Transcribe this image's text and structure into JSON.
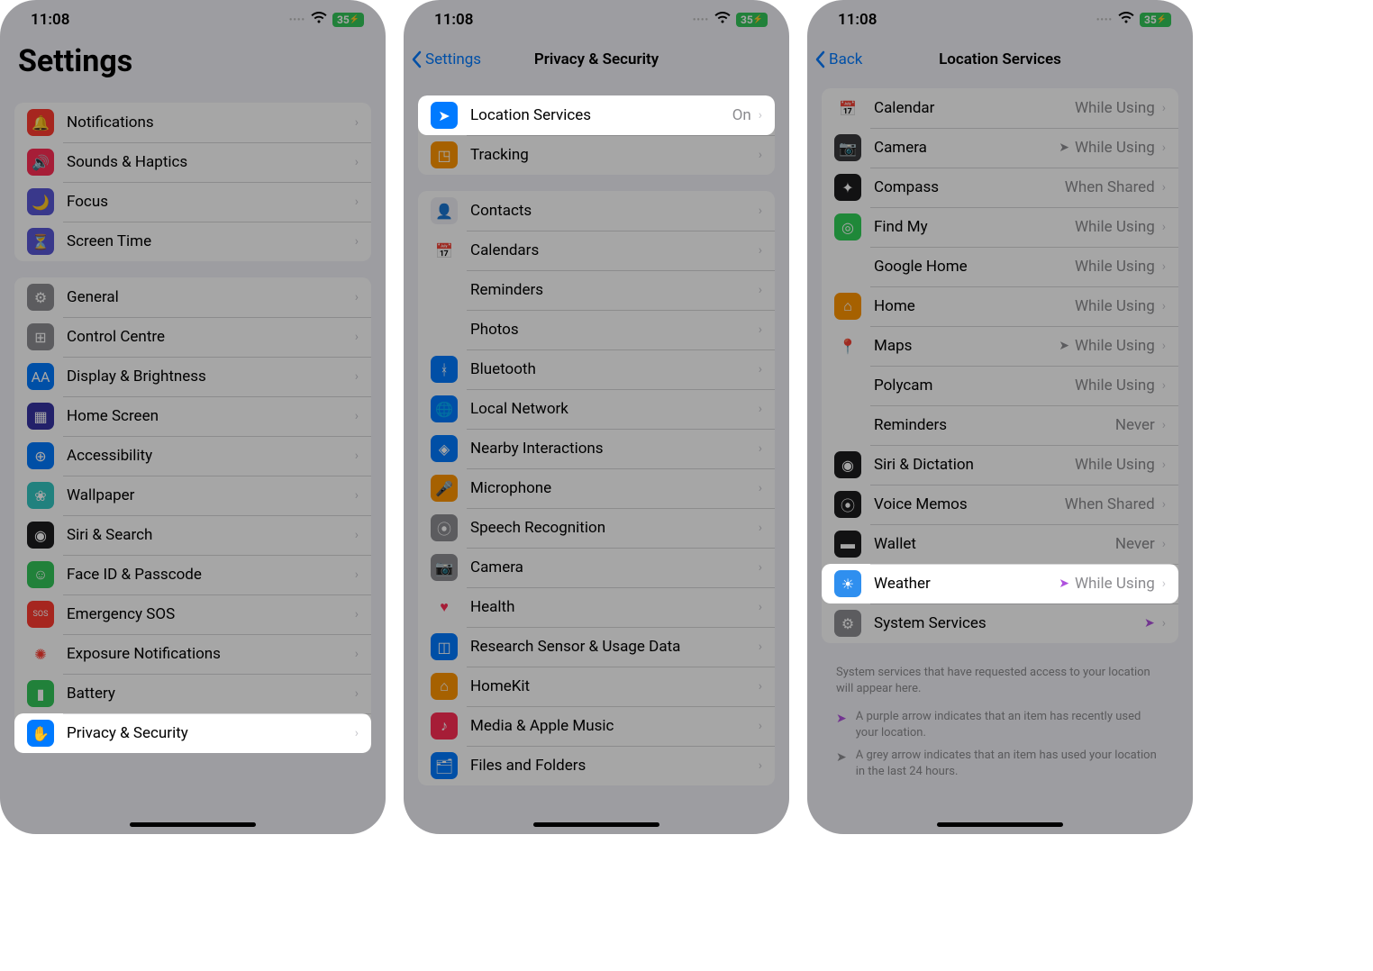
{
  "status": {
    "time": "11:08",
    "battery": "35"
  },
  "panel1": {
    "title": "Settings",
    "group1": [
      {
        "label": "Notifications",
        "color": "#ff3b30",
        "glyph": "🔔"
      },
      {
        "label": "Sounds & Haptics",
        "color": "#ff2d55",
        "glyph": "🔊"
      },
      {
        "label": "Focus",
        "color": "#5856d6",
        "glyph": "🌙"
      },
      {
        "label": "Screen Time",
        "color": "#5856d6",
        "glyph": "⏳"
      }
    ],
    "group2": [
      {
        "label": "General",
        "color": "#8e8e93",
        "glyph": "⚙"
      },
      {
        "label": "Control Centre",
        "color": "#8e8e93",
        "glyph": "⊞"
      },
      {
        "label": "Display & Brightness",
        "color": "#007aff",
        "glyph": "AA"
      },
      {
        "label": "Home Screen",
        "color": "#3634a3",
        "glyph": "▦"
      },
      {
        "label": "Accessibility",
        "color": "#007aff",
        "glyph": "⊕"
      },
      {
        "label": "Wallpaper",
        "color": "#34c7c2",
        "glyph": "❀"
      },
      {
        "label": "Siri & Search",
        "color": "#1c1c1e",
        "glyph": "◉"
      },
      {
        "label": "Face ID & Passcode",
        "color": "#34c759",
        "glyph": "☺"
      },
      {
        "label": "Emergency SOS",
        "color": "#ff3b30",
        "glyph": "SOS"
      },
      {
        "label": "Exposure Notifications",
        "color": "#ffffff",
        "glyph": "✺",
        "glyphColor": "#ff3b30"
      },
      {
        "label": "Battery",
        "color": "#34c759",
        "glyph": "▮"
      },
      {
        "label": "Privacy & Security",
        "color": "#007aff",
        "glyph": "✋",
        "highlight": true
      }
    ]
  },
  "panel2": {
    "back": "Settings",
    "title": "Privacy & Security",
    "group1": [
      {
        "label": "Location Services",
        "value": "On",
        "color": "#007aff",
        "glyph": "➤",
        "highlight": true
      },
      {
        "label": "Tracking",
        "color": "#ff9500",
        "glyph": "◳"
      }
    ],
    "group2": [
      {
        "label": "Contacts",
        "color": "#efeff4",
        "glyph": "👤"
      },
      {
        "label": "Calendars",
        "color": "#ffffff",
        "glyph": "📅"
      },
      {
        "label": "Reminders",
        "color": "#ffffff",
        "glyph": "⋮"
      },
      {
        "label": "Photos",
        "color": "#ffffff",
        "glyph": "❋"
      },
      {
        "label": "Bluetooth",
        "color": "#007aff",
        "glyph": "ᚼ"
      },
      {
        "label": "Local Network",
        "color": "#007aff",
        "glyph": "🌐"
      },
      {
        "label": "Nearby Interactions",
        "color": "#007aff",
        "glyph": "◈"
      },
      {
        "label": "Microphone",
        "color": "#ff9500",
        "glyph": "🎤"
      },
      {
        "label": "Speech Recognition",
        "color": "#8e8e93",
        "glyph": "⦿"
      },
      {
        "label": "Camera",
        "color": "#8e8e93",
        "glyph": "📷"
      },
      {
        "label": "Health",
        "color": "#ffffff",
        "glyph": "♥",
        "glyphColor": "#ff2d55"
      },
      {
        "label": "Research Sensor & Usage Data",
        "color": "#007aff",
        "glyph": "◫"
      },
      {
        "label": "HomeKit",
        "color": "#ff9500",
        "glyph": "⌂"
      },
      {
        "label": "Media & Apple Music",
        "color": "#ff2d55",
        "glyph": "♪"
      },
      {
        "label": "Files and Folders",
        "color": "#007aff",
        "glyph": "🗂"
      }
    ]
  },
  "panel3": {
    "back": "Back",
    "title": "Location Services",
    "apps": [
      {
        "label": "Calendar",
        "value": "While Using",
        "iconBg": "#ffffff",
        "glyph": "📅"
      },
      {
        "label": "Camera",
        "value": "While Using",
        "arrow": "grey",
        "iconBg": "#3a3a3c",
        "glyph": "📷"
      },
      {
        "label": "Compass",
        "value": "When Shared",
        "iconBg": "#1c1c1e",
        "glyph": "✦"
      },
      {
        "label": "Find My",
        "value": "While Using",
        "iconBg": "#30d158",
        "glyph": "◎"
      },
      {
        "label": "Google Home",
        "value": "While Using",
        "iconBg": "#ffffff",
        "glyph": "⌂"
      },
      {
        "label": "Home",
        "value": "While Using",
        "iconBg": "#ff9500",
        "glyph": "⌂"
      },
      {
        "label": "Maps",
        "value": "While Using",
        "arrow": "grey",
        "iconBg": "#ffffff",
        "glyph": "📍"
      },
      {
        "label": "Polycam",
        "value": "While Using",
        "iconBg": "#ffffff",
        "glyph": "ᘔ"
      },
      {
        "label": "Reminders",
        "value": "Never",
        "iconBg": "#ffffff",
        "glyph": "⋮"
      },
      {
        "label": "Siri & Dictation",
        "value": "While Using",
        "iconBg": "#1c1c1e",
        "glyph": "◉"
      },
      {
        "label": "Voice Memos",
        "value": "When Shared",
        "iconBg": "#1c1c1e",
        "glyph": "⦿"
      },
      {
        "label": "Wallet",
        "value": "Never",
        "iconBg": "#1c1c1e",
        "glyph": "▬"
      },
      {
        "label": "Weather",
        "value": "While Using",
        "arrow": "purple",
        "iconBg": "#2f8fef",
        "glyph": "☀",
        "highlight": true
      },
      {
        "label": "System Services",
        "value": "",
        "arrow": "purple",
        "iconBg": "#8e8e93",
        "glyph": "⚙"
      }
    ],
    "footer": "System services that have requested access to your location will appear here.",
    "legendPurple": "A purple arrow indicates that an item has recently used your location.",
    "legendGrey": "A grey arrow indicates that an item has used your location in the last 24 hours."
  }
}
